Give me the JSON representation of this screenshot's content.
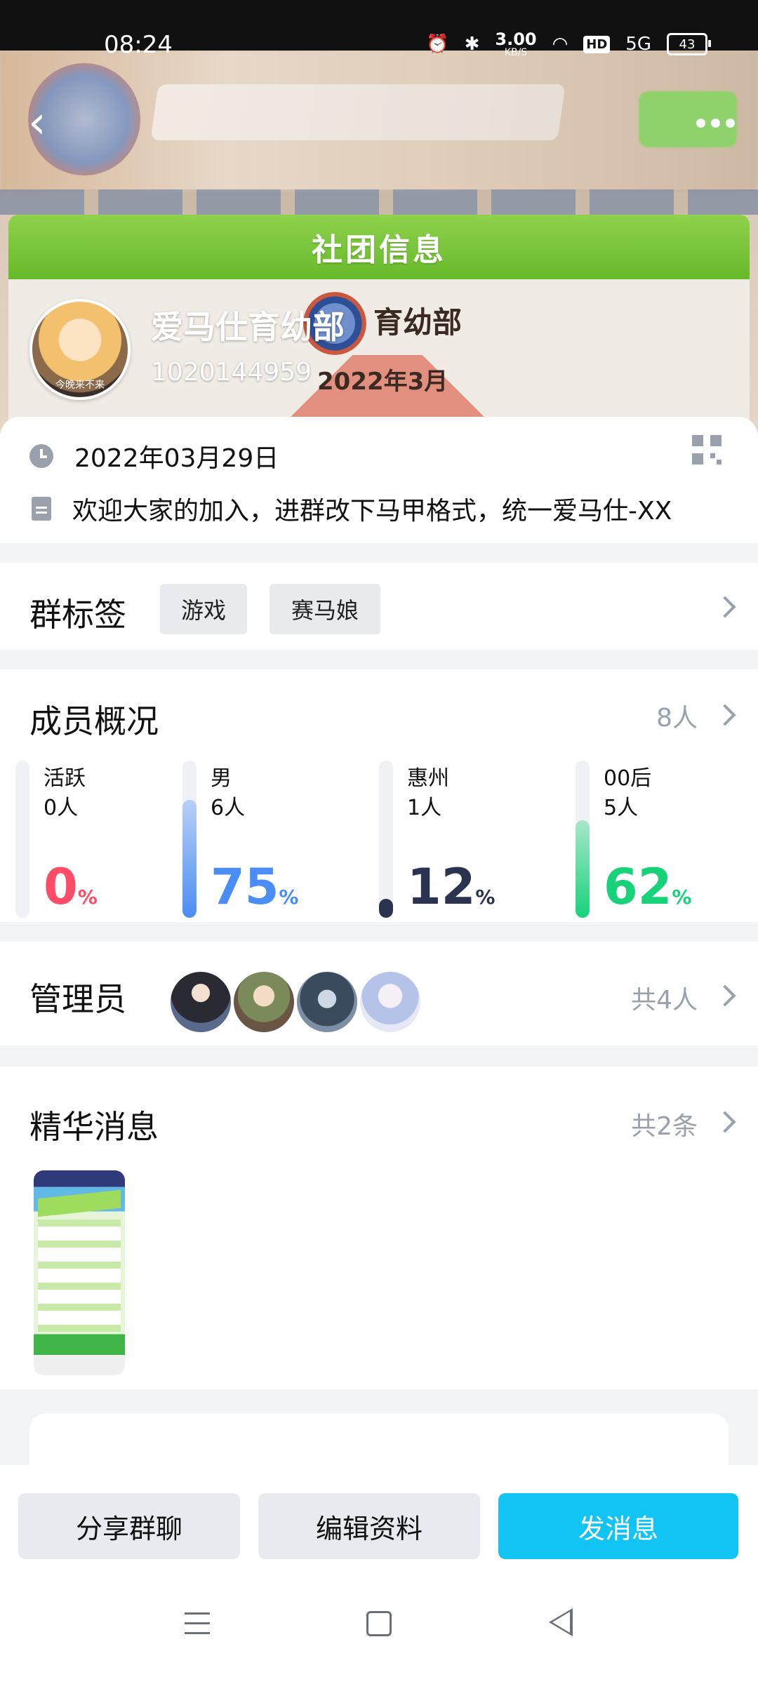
{
  "status_bar": {
    "time": "08:24",
    "net_speed": "3.00",
    "net_unit": "KB/S",
    "hd": "HD",
    "signal": "5G",
    "battery": "43"
  },
  "banner": {
    "card_title": "社团信息",
    "poster_club": "育幼部",
    "poster_date": "2022年3月"
  },
  "group": {
    "name": "爱马仕育幼部",
    "id": "1020144959",
    "avatar_caption": "今晚来不来"
  },
  "info": {
    "date": "2022年03月29日",
    "intro": "欢迎大家的加入，进群改下马甲格式，统一爱马仕-XX"
  },
  "tags": {
    "title": "群标签",
    "items": [
      "游戏",
      "赛马娘"
    ]
  },
  "members": {
    "title": "成员概况",
    "count": "8人",
    "stats": [
      {
        "label": "活跃",
        "count": "0人",
        "percent": "0",
        "fraction": 0.0,
        "color": "#ff4d67"
      },
      {
        "label": "男",
        "count": "6人",
        "percent": "75",
        "fraction": 0.75,
        "color": "#4a8df6"
      },
      {
        "label": "惠州",
        "count": "1人",
        "percent": "12",
        "fraction": 0.12,
        "color": "#2a3350"
      },
      {
        "label": "00后",
        "count": "5人",
        "percent": "62",
        "fraction": 0.62,
        "color": "#18d27a"
      }
    ],
    "percent_sign": "%"
  },
  "admins": {
    "title": "管理员",
    "count": "共4人"
  },
  "essence": {
    "title": "精华消息",
    "count": "共2条"
  },
  "actions": {
    "share": "分享群聊",
    "edit": "编辑资料",
    "send": "发消息"
  },
  "colors": {
    "accent": "#12c4f4",
    "header_green": "#67b92b"
  }
}
